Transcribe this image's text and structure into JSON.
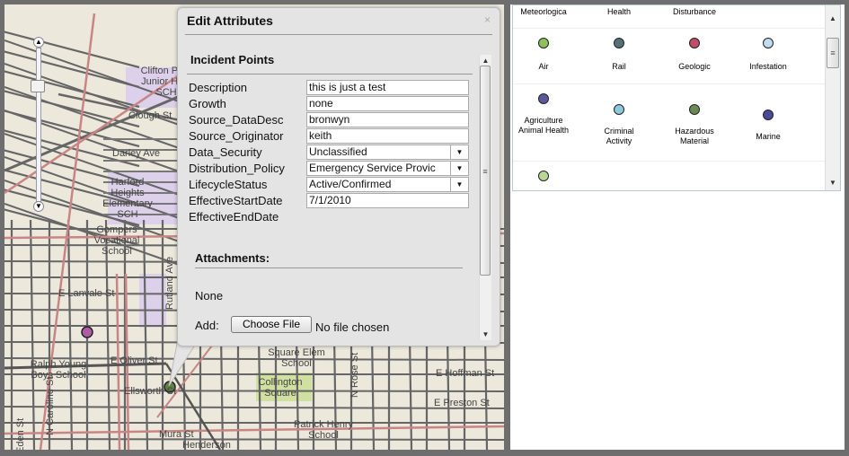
{
  "map": {
    "labels": [
      "Clifton Park Junior High SCH",
      "Clough St",
      "Darley Ave",
      "Harford Heights Elementary SCH",
      "Gompers Vocational School",
      "E Lanvale St",
      "Rutland Ave",
      "Ralph Young Boys School",
      "E Oliver St",
      "Ellsworth St",
      "Square Elem School",
      "Collington Square",
      "N Rose St",
      "E Hoffman St",
      "E Preston St",
      "Patrick Henry School",
      "Henderson",
      "Mura St",
      "N Caroline St",
      "Eden St",
      "Ave"
    ],
    "markers": [
      {
        "color": "#b05aa8"
      },
      {
        "color": "#5f7f45"
      }
    ],
    "zoom_slider": {
      "level": 0.88
    }
  },
  "popup": {
    "title": "Edit Attributes",
    "close": "×",
    "section": "Incident Points",
    "fields": [
      {
        "label": "Description",
        "value": "this is just a test"
      },
      {
        "label": "Growth",
        "value": "none"
      },
      {
        "label": "Source_DataDesc",
        "value": "bronwyn"
      },
      {
        "label": "Source_Originator",
        "value": "keith"
      },
      {
        "label": "Data_Security",
        "value": "Unclassified",
        "dropdown": true
      },
      {
        "label": "Distribution_Policy",
        "value": "Emergency Service Provic",
        "dropdown": true
      },
      {
        "label": "LifecycleStatus",
        "value": "Active/Confirmed",
        "dropdown": true
      },
      {
        "label": "EffectiveStartDate",
        "value": "7/1/2010"
      },
      {
        "label": "EffectiveEndDate",
        "value": ""
      }
    ],
    "attachments": "Attachments:",
    "none": "None",
    "add": "Add:",
    "choose_file": "Choose File",
    "no_file": "No file chosen"
  },
  "legend": {
    "top_row": [
      "Meteorlogica",
      "Health",
      "Disturbance"
    ],
    "rows": [
      [
        {
          "label": "Air",
          "color": "#8fc05a"
        },
        {
          "label": "Rail",
          "color": "#56707a"
        },
        {
          "label": "Geologic",
          "color": "#c24a6a"
        },
        {
          "label": "Infestation",
          "color": "#c0dcf0"
        }
      ],
      [
        {
          "label": "Agriculture Animal Health",
          "color": "#5a5a9a"
        },
        {
          "label": "Criminal Activity",
          "color": "#8ccadb"
        },
        {
          "label": "Hazardous Material",
          "color": "#6a8a55"
        },
        {
          "label": "Marine",
          "color": "#4a4a9a"
        }
      ],
      [
        {
          "label": "",
          "color": "#b8d89a"
        }
      ]
    ]
  }
}
